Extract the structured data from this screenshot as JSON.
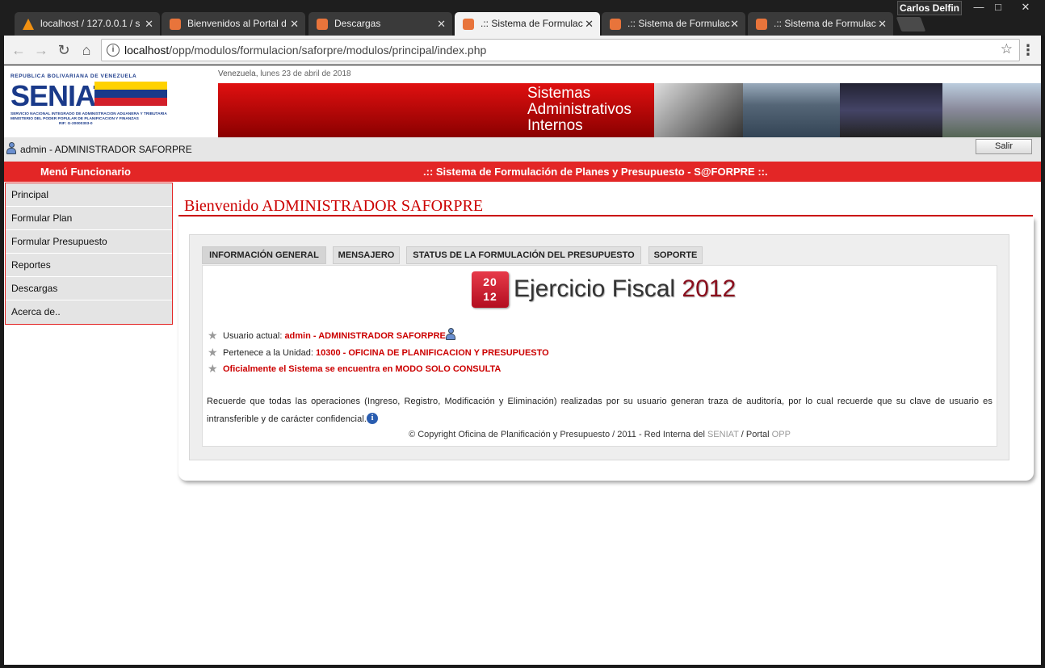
{
  "browser": {
    "profile_name": "Carlos Delfin",
    "tabs": [
      {
        "title": "localhost / 127.0.0.1 / s",
        "active": false,
        "icon": "phpmyadmin-icon"
      },
      {
        "title": "Bienvenidos al Portal d",
        "active": false,
        "icon": "xampp-icon"
      },
      {
        "title": "Descargas",
        "active": false,
        "icon": "xampp-icon"
      },
      {
        "title": ".:: Sistema de Formulac",
        "active": true,
        "icon": "xampp-icon"
      },
      {
        "title": ".:: Sistema de Formulac",
        "active": false,
        "icon": "xampp-icon"
      },
      {
        "title": ".:: Sistema de Formulac",
        "active": false,
        "icon": "xampp-icon"
      }
    ],
    "url_host": "localhost",
    "url_path": "/opp/modulos/formulacion/saforpre/modulos/principal/index.php"
  },
  "header": {
    "date_place": "Venezuela,",
    "date_text": "lunes 23 de abril de 2018",
    "logo_top": "REPUBLICA BOLIVARIANA DE VENEZUELA",
    "logo_main": "SENIAT",
    "logo_sub1": "SERVICIO NACIONAL INTEGRADO DE ADMINISTRACION ADUANERA Y TRIBUTARIA",
    "logo_sub2": "MINISTERIO DEL PODER POPULAR DE PLANIFICACION Y FINANZAS",
    "logo_rif": "RIF: G-20000303-0",
    "banner_line1": "Sistemas",
    "banner_line2": "Administrativos",
    "banner_line3": "Internos"
  },
  "userbar": {
    "user_text": "admin - ADMINISTRADOR SAFORPRE",
    "logout_label": "Salir"
  },
  "redbar": {
    "menu_title": "Menú Funcionario",
    "system_title": ".:: Sistema de Formulación de Planes y Presupuesto - S@FORPRE ::."
  },
  "sidemenu": {
    "items": [
      "Principal",
      "Formular Plan",
      "Formular Presupuesto",
      "Reportes",
      "Descargas",
      "Acerca de.."
    ]
  },
  "main": {
    "welcome": "Bienvenido ADMINISTRADOR SAFORPRE",
    "tabs": [
      "INFORMACIÓN GENERAL",
      "MENSAJERO",
      "STATUS DE LA FORMULACIÓN DEL PRESUPUESTO",
      "SOPORTE"
    ],
    "fiscal_icon_text_top": "20",
    "fiscal_icon_text_bottom": "12",
    "fiscal_label": "Ejercicio Fiscal",
    "fiscal_year": "2012",
    "user_label": "Usuario actual:",
    "user_value": "admin - ADMINISTRADOR SAFORPRE",
    "unit_label": "Pertenece a la Unidad:",
    "unit_value": "10300 - OFICINA DE PLANIFICACION Y PRESUPUESTO",
    "mode_notice": "Oficialmente el Sistema se encuentra en MODO SOLO CONSULTA",
    "reminder": "Recuerde que todas las operaciones (Ingreso, Registro, Modificación y Eliminación) realizadas por su usuario generan traza de auditoría, por lo cual recuerde que su clave de usuario es intransferible y de carácter confidencial.",
    "copyright_pre": "© Copyright Oficina de Planificación y Presupuesto / 2011 - Red Interna del",
    "copyright_link1": "SENIAT",
    "copyright_mid": "/ Portal",
    "copyright_link2": "OPP"
  },
  "colors": {
    "accent_red": "#e32626",
    "title_red": "#cc0000",
    "year_color": "#8a0d1c"
  }
}
